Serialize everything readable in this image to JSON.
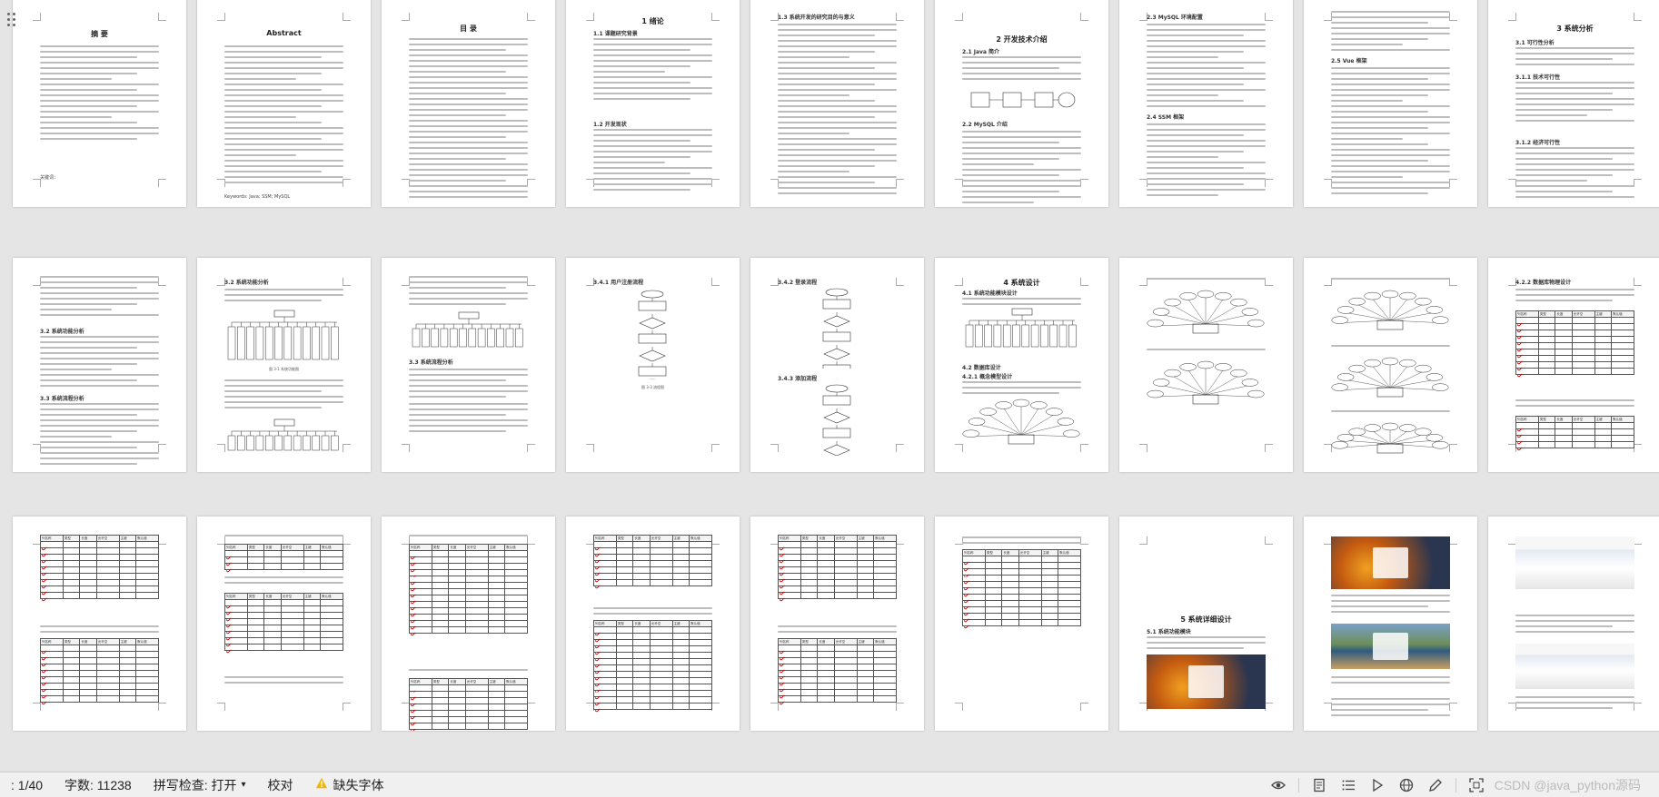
{
  "status_bar": {
    "page_indicator": ": 1/40",
    "word_count": "字数: 11238",
    "spell_check": "拼写检查: 打开",
    "proofread": "校对",
    "missing_fonts": "缺失字体",
    "watermark": "CSDN @java_python源码"
  },
  "pages": {
    "p1": {
      "heading": "摘 要",
      "keywords": "关键词："
    },
    "p2": {
      "heading": "Abstract",
      "keywords": "Keywords: Java; SSM; MySQL"
    },
    "p3": {
      "heading": "目 录"
    },
    "p4": {
      "heading": "1 绪论",
      "s1": "1.1 课题研究背景",
      "s2": "1.2 开发现状"
    },
    "p5": {
      "heading": "1.3 系统开发的研究目的与意义"
    },
    "p6": {
      "heading": "2 开发技术介绍",
      "s1": "2.1 Java 简介",
      "s2": "2.2 MySQL 介绍"
    },
    "p7": {
      "s1": "2.3 MySQL 环境配置",
      "s2": "2.4 SSM 框架"
    },
    "p8": {
      "s1": "2.5 Vue 框架"
    },
    "p9": {
      "heading": "3 系统分析",
      "s1": "3.1 可行性分析",
      "s2": "3.1.1 技术可行性",
      "s3": "3.1.2 经济可行性"
    },
    "p11": {
      "s1": "3.2 系统功能分析",
      "s2": "3.3 系统流程分析"
    },
    "p12": {
      "caption": "图 3-1 系统功能图"
    },
    "p13": {
      "s1": "3.4.1 用户注册流程",
      "caption": "图 3-3 流程图"
    },
    "p14": {
      "s1": "3.4.2 登录流程",
      "s2": "3.4.3 添加流程"
    },
    "p15": {
      "heading": "4 系统设计",
      "s1": "4.1 系统功能模块设计",
      "s2": "4.2 数据库设计",
      "s3": "4.2.1 概念模型设计"
    },
    "p18": {
      "s1": "4.2.2 数据库物理设计"
    },
    "p25": {
      "heading": "5 系统详细设计",
      "s1": "5.1 系统功能模块"
    }
  },
  "table_headers": [
    "列名称",
    "类型",
    "长度",
    "允许空",
    "主键",
    "默认值"
  ]
}
